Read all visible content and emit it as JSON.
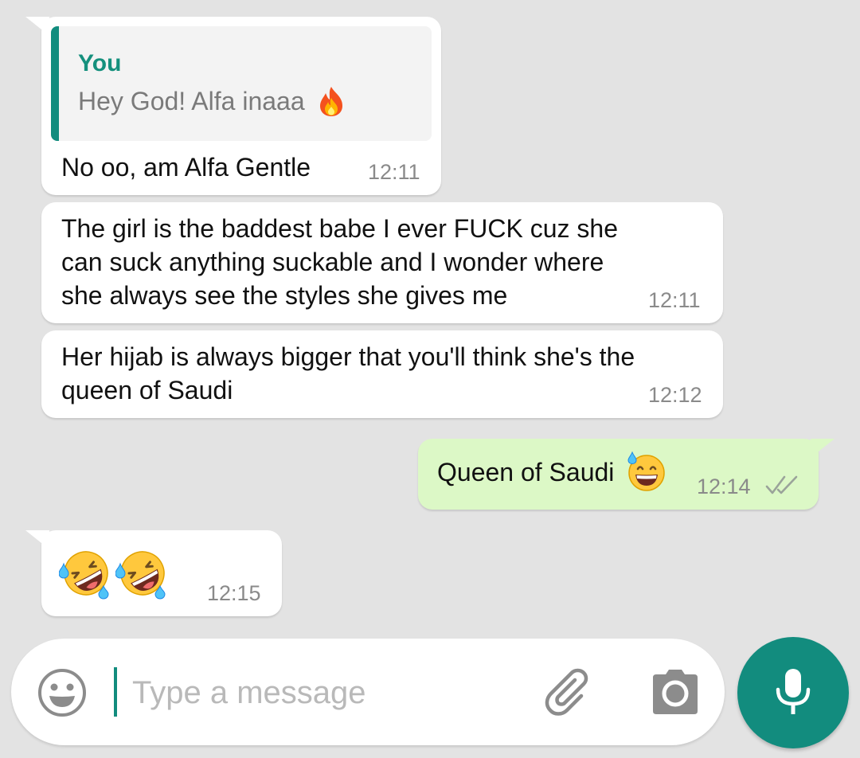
{
  "colors": {
    "accent": "#128c7e",
    "incoming_bubble": "#ffffff",
    "outgoing_bubble": "#dcf8c6",
    "background": "#e3e3e3",
    "timestamp": "#8a8a8a"
  },
  "messages": [
    {
      "direction": "incoming",
      "quote": {
        "author": "You",
        "text": "Hey God! Alfa inaaa",
        "emoji": "fire-emoji"
      },
      "text": "No oo, am Alfa Gentle",
      "time": "12:11"
    },
    {
      "direction": "incoming",
      "lines": [
        "The girl is the baddest babe I ever FUCK cuz she",
        "can suck anything suckable and I wonder where",
        "she always see the styles she gives me"
      ],
      "time": "12:11"
    },
    {
      "direction": "incoming",
      "lines": [
        "Her hijab is always bigger that you'll think she's the",
        "queen of Saudi"
      ],
      "time": "12:12"
    },
    {
      "direction": "outgoing",
      "text": "Queen of Saudi",
      "emoji": "grinning-sweat-emoji",
      "time": "12:14",
      "status_icon": "double-check-icon"
    },
    {
      "direction": "incoming",
      "emojis": [
        "rolling-on-floor-laughing-emoji",
        "rolling-on-floor-laughing-emoji"
      ],
      "time": "12:15"
    }
  ],
  "input_bar": {
    "placeholder": "Type a message",
    "emoji_icon": "smiley-icon",
    "attach_icon": "paperclip-icon",
    "camera_icon": "camera-icon",
    "mic_icon": "microphone-icon"
  }
}
